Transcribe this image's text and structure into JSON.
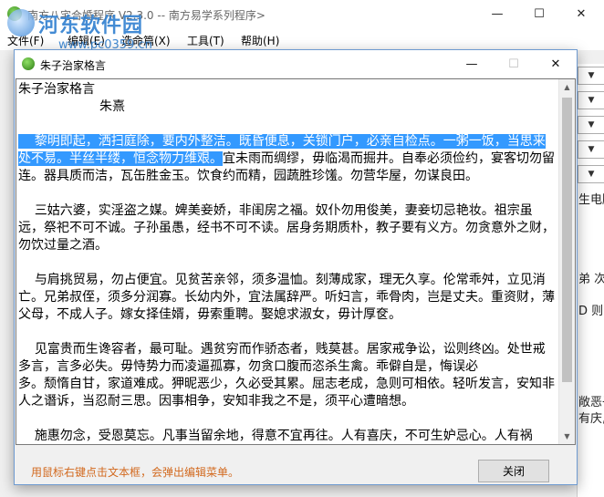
{
  "background_app": {
    "title": "南方八宅合婚程序 V2.3.0 -- 南方易学系列程序>",
    "menu": [
      "文件(F)",
      "编辑(E)",
      "造命篇(X)",
      "工具(T)",
      "帮助(H)"
    ],
    "watermark": {
      "name": "河东软件园",
      "url": "www.pc0359.cn"
    },
    "right_panel_fragments": [
      "生电脑",
      "弟 次",
      "D 则",
      "敞恶子",
      "有庆,"
    ]
  },
  "dialog": {
    "title": "朱子治家格言",
    "text_lines": [
      {
        "text": "朱子治家格言"
      },
      {
        "text": "                    朱熹"
      },
      {
        "text": ""
      },
      {
        "selected": "    黎明即起，洒扫庭除，要内外整洁。既昏便息，关锁门户，必亲自检点。一粥一饭，当思来处不易。半丝半缕，恒念物力维艰。",
        "rest": "宜未雨而绸缪，毋临渴而掘井。自奉必须俭约，宴客切勿留连。器具质而洁，瓦缶胜金玉。饮食约而精，园蔬胜珍馐。勿营华屋，勿谋良田。"
      },
      {
        "text": ""
      },
      {
        "text": "    三姑六婆，实淫盗之媒。婢美妾娇，非闺房之福。奴仆勿用俊美，妻妾切忌艳妆。祖宗虽远，祭祀不可不诚。子孙虽愚，经书不可不读。居身务期质朴，教子要有义方。勿贪意外之财，勿饮过量之酒。"
      },
      {
        "text": ""
      },
      {
        "text": "    与肩挑贸易，勿占便宜。见贫苦亲邻，须多温恤。刻薄成家，理无久享。伦常乖舛，立见消亡。兄弟叔侄，须多分润寡。长幼内外，宜法属辞严。听妇言，乖骨肉，岂是丈夫。重资财，薄父母，不成人子。嫁女择佳婿，毋索重聘。娶媳求淑女，毋计厚奁。"
      },
      {
        "text": ""
      },
      {
        "text": "    见富贵而生谗容者，最可耻。遇贫穷而作骄态者，贱莫甚。居家戒争讼，讼则终凶。处世戒多言，言多必失。毋恃势力而凌逼孤寡，勿贪口腹而恣杀生禽。乖僻自是，悔误必"
      },
      {
        "text": "多。颓惰自甘，家道难成。狎昵恶少，久必受其累。屈志老成，急则可相依。轻听发言，安知非人之谮诉，当忍耐三思。因事相争，安知非我之不是，须平心遭暗想。"
      },
      {
        "text": ""
      },
      {
        "text": "    施惠勿念，受恩莫忘。凡事当留余地，得意不宜再往。人有喜庆，不可生妒忌心。人有祸患，不可生喜幸心。善欲人见，不是真善。恶恐人知，便是大恶。见色而起淫心，报在妻女。匿怨而用暗箭，祸延子孙。"
      }
    ],
    "hint": "用鼠标右键点击文本框，会弹出编辑菜单。",
    "close_button": "关闭"
  },
  "colors": {
    "selection": "#3399ff",
    "hint_text": "#d2691e",
    "watermark": "#2f7fd0"
  }
}
